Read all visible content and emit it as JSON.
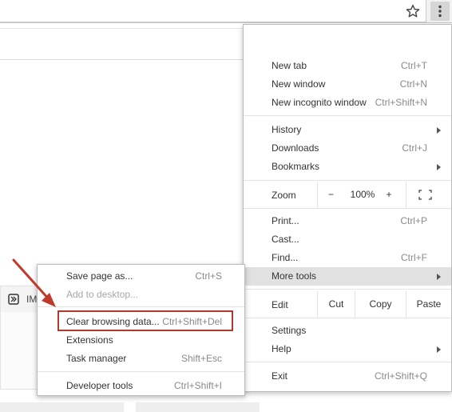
{
  "main_menu": {
    "items": [
      {
        "label": "New tab",
        "shortcut": "Ctrl+T"
      },
      {
        "label": "New window",
        "shortcut": "Ctrl+N"
      },
      {
        "label": "New incognito window",
        "shortcut": "Ctrl+Shift+N"
      },
      {
        "label": "History",
        "shortcut": ""
      },
      {
        "label": "Downloads",
        "shortcut": "Ctrl+J"
      },
      {
        "label": "Bookmarks",
        "shortcut": ""
      },
      {
        "label": "Print...",
        "shortcut": "Ctrl+P"
      },
      {
        "label": "Cast...",
        "shortcut": ""
      },
      {
        "label": "Find...",
        "shortcut": "Ctrl+F"
      },
      {
        "label": "More tools",
        "shortcut": ""
      },
      {
        "label": "Settings",
        "shortcut": ""
      },
      {
        "label": "Help",
        "shortcut": ""
      },
      {
        "label": "Exit",
        "shortcut": "Ctrl+Shift+Q"
      }
    ],
    "zoom": {
      "label": "Zoom",
      "minus": "−",
      "value": "100%",
      "plus": "+"
    },
    "edit": {
      "label": "Edit",
      "cut": "Cut",
      "copy": "Copy",
      "paste": "Paste"
    }
  },
  "more_tools": {
    "items": [
      {
        "label": "Save page as...",
        "shortcut": "Ctrl+S"
      },
      {
        "label": "Add to desktop...",
        "shortcut": ""
      },
      {
        "label": "Clear browsing data...",
        "shortcut": "Ctrl+Shift+Del"
      },
      {
        "label": "Extensions",
        "shortcut": ""
      },
      {
        "label": "Task manager",
        "shortcut": "Shift+Esc"
      },
      {
        "label": "Developer tools",
        "shortcut": "Ctrl+Shift+I"
      }
    ]
  },
  "page": {
    "card_title": "IM"
  },
  "icons": {
    "bookmark": "star-icon",
    "menu": "three-dot-menu-icon",
    "fullscreen": "fullscreen-icon",
    "submenu": "chevron-right-icon"
  },
  "colors": {
    "annotation": "#b03a2e",
    "hover": "#e1e1e1"
  }
}
